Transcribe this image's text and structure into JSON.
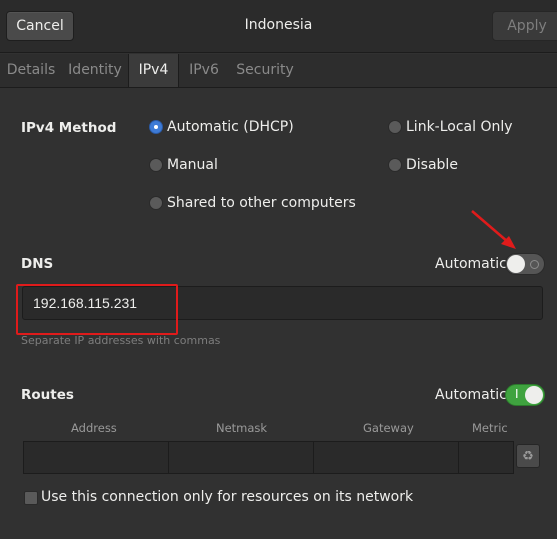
{
  "header": {
    "cancel_label": "Cancel",
    "title": "Indonesia",
    "apply_label": "Apply"
  },
  "tabs": [
    {
      "label": "Details",
      "active": false
    },
    {
      "label": "Identity",
      "active": false
    },
    {
      "label": "IPv4",
      "active": true
    },
    {
      "label": "IPv6",
      "active": false
    },
    {
      "label": "Security",
      "active": false
    }
  ],
  "ipv4_method": {
    "label": "IPv4 Method",
    "options": [
      {
        "label": "Automatic (DHCP)",
        "selected": true
      },
      {
        "label": "Link-Local Only",
        "selected": false
      },
      {
        "label": "Manual",
        "selected": false
      },
      {
        "label": "Disable",
        "selected": false
      },
      {
        "label": "Shared to other computers",
        "selected": false
      }
    ]
  },
  "dns": {
    "label": "DNS",
    "automatic_label": "Automatic",
    "automatic_on": false,
    "value": "192.168.115.231",
    "hint": "Separate IP addresses with commas"
  },
  "routes": {
    "label": "Routes",
    "automatic_label": "Automatic",
    "automatic_on": true,
    "switch_on_mark": "I",
    "columns": [
      "Address",
      "Netmask",
      "Gateway",
      "Metric"
    ],
    "row": [
      "",
      "",
      "",
      ""
    ]
  },
  "restrict": {
    "label": "Use this connection only for resources on its network",
    "checked": false
  },
  "colors": {
    "accent_radio": "#3e7bd6",
    "switch_on": "#3fa33f",
    "highlight": "#e01b1b"
  }
}
